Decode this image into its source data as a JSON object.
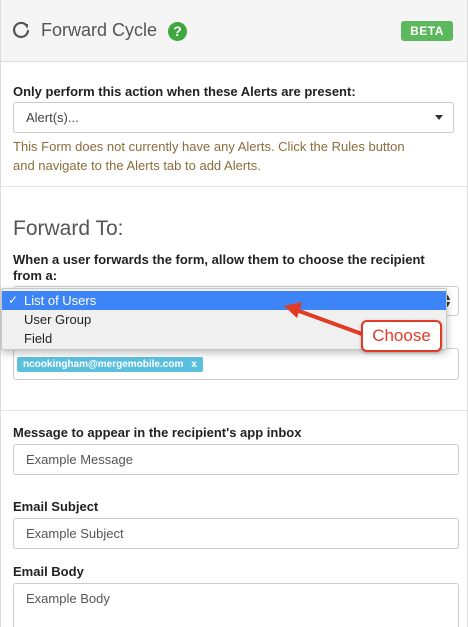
{
  "header": {
    "title": "Forward Cycle",
    "help_glyph": "?",
    "badge": "BETA",
    "icon": "refresh-icon"
  },
  "alerts": {
    "label": "Only perform this action when these Alerts are present:",
    "select_value": "Alert(s)...",
    "warning_line1": "This Form does not currently have any Alerts. Click the Rules button",
    "warning_line2": "and navigate to the Alerts tab to add Alerts."
  },
  "forward": {
    "heading": "Forward To:",
    "question_line1": "When a user forwards the form, allow them to choose the recipient",
    "question_line2": "from a:",
    "options": [
      {
        "label": "List of Users",
        "selected": true
      },
      {
        "label": "User Group",
        "selected": false
      },
      {
        "label": "Field",
        "selected": false
      }
    ],
    "checkmark": "✓",
    "recipient_tag": "ncookingham@mergemobile.com",
    "tag_remove": "x"
  },
  "annotation": {
    "callout": "Choose",
    "color": "#e23b25"
  },
  "message": {
    "label": "Message to appear in the recipient's app inbox",
    "value": "Example Message"
  },
  "email_subject": {
    "label": "Email Subject",
    "value": "Example Subject"
  },
  "email_body": {
    "label": "Email Body",
    "value": "Example Body"
  },
  "colors": {
    "beta": "#5cb85c",
    "help": "#3ea83e",
    "warning_text": "#8a6d3b",
    "tag": "#5bc0de",
    "selected_option": "#3d84f6"
  }
}
